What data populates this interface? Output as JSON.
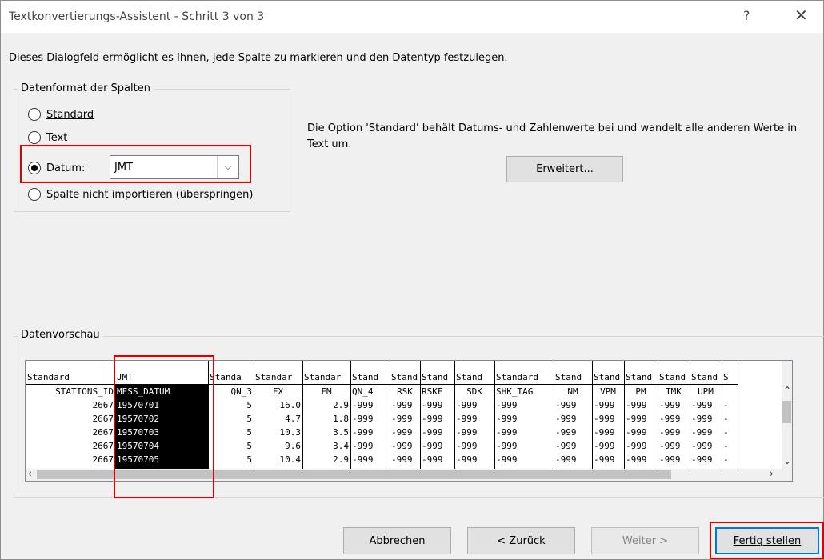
{
  "window": {
    "title": "Textkonvertierungs-Assistent - Schritt 3 von 3",
    "help": "?",
    "close": "✕"
  },
  "intro": "Dieses Dialogfeld ermöglicht es Ihnen, jede Spalte zu markieren und den Datentyp festzulegen.",
  "format_group": {
    "label": "Datenformat der Spalten",
    "options": [
      {
        "label": "Standard",
        "selected": false
      },
      {
        "label": "Text",
        "selected": false
      },
      {
        "label": "Datum:",
        "selected": true
      },
      {
        "label": "Spalte nicht importieren (überspringen)",
        "selected": false
      }
    ],
    "date_format": "JMT"
  },
  "description": "Die Option 'Standard' behält Datums- und Zahlenwerte bei und wandelt alle anderen Werte in Text um.",
  "advanced_button": "Erweitert...",
  "preview": {
    "label": "Datenvorschau",
    "columns": [
      {
        "type": "Standard",
        "name": "STATIONS_ID",
        "values": [
          "2667",
          "2667",
          "2667",
          "2667",
          "2667"
        ],
        "align": "right",
        "selected": false
      },
      {
        "type": "JMT",
        "name": "MESS_DATUM",
        "values": [
          "19570701",
          "19570702",
          "19570703",
          "19570704",
          "19570705"
        ],
        "align": "left",
        "selected": true
      },
      {
        "type": "Standa",
        "name": "QN_3",
        "values": [
          "5",
          "5",
          "5",
          "5",
          "5"
        ],
        "align": "right",
        "selected": false
      },
      {
        "type": "Standar",
        "name": "FX",
        "values": [
          "16.0",
          "4.7",
          "10.3",
          "9.6",
          "10.4"
        ],
        "align": "right",
        "selected": false
      },
      {
        "type": "Standar",
        "name": "FM",
        "values": [
          "2.9",
          "1.8",
          "3.5",
          "3.4",
          "2.9"
        ],
        "align": "right",
        "selected": false
      },
      {
        "type": "Stand",
        "name": "QN_4",
        "values": [
          "-999",
          "-999",
          "-999",
          "-999",
          "-999"
        ],
        "align": "left",
        "selected": false
      },
      {
        "type": "Stand",
        "name": "RSK",
        "values": [
          "-999",
          "-999",
          "-999",
          "-999",
          "-999"
        ],
        "align": "left",
        "selected": false
      },
      {
        "type": "Stand",
        "name": "RSKF",
        "values": [
          "-999",
          "-999",
          "-999",
          "-999",
          "-999"
        ],
        "align": "left",
        "selected": false
      },
      {
        "type": "Stand",
        "name": "SDK",
        "values": [
          "-999",
          "-999",
          "-999",
          "-999",
          "-999"
        ],
        "align": "left",
        "selected": false
      },
      {
        "type": "Standard",
        "name": "SHK_TAG",
        "values": [
          "-999",
          "-999",
          "-999",
          "-999",
          "-999"
        ],
        "align": "left",
        "selected": false
      },
      {
        "type": "Stand",
        "name": "NM",
        "values": [
          "-999",
          "-999",
          "-999",
          "-999",
          "-999"
        ],
        "align": "left",
        "selected": false
      },
      {
        "type": "Stand",
        "name": "VPM",
        "values": [
          "-999",
          "-999",
          "-999",
          "-999",
          "-999"
        ],
        "align": "left",
        "selected": false
      },
      {
        "type": "Stand",
        "name": "PM",
        "values": [
          "-999",
          "-999",
          "-999",
          "-999",
          "-999"
        ],
        "align": "left",
        "selected": false
      },
      {
        "type": "Stand",
        "name": "TMK",
        "values": [
          "-999",
          "-999",
          "-999",
          "-999",
          "-999"
        ],
        "align": "left",
        "selected": false
      },
      {
        "type": "Stand",
        "name": "UPM",
        "values": [
          "-999",
          "-999",
          "-999",
          "-999",
          "-999"
        ],
        "align": "left",
        "selected": false
      },
      {
        "type": "S",
        "name": "",
        "values": [
          "-",
          "-",
          "-",
          "-",
          "-"
        ],
        "align": "left",
        "selected": false
      }
    ]
  },
  "buttons": {
    "cancel": "Abbrechen",
    "back": "< Zurück",
    "next": "Weiter >",
    "finish": "Fertig stellen"
  }
}
